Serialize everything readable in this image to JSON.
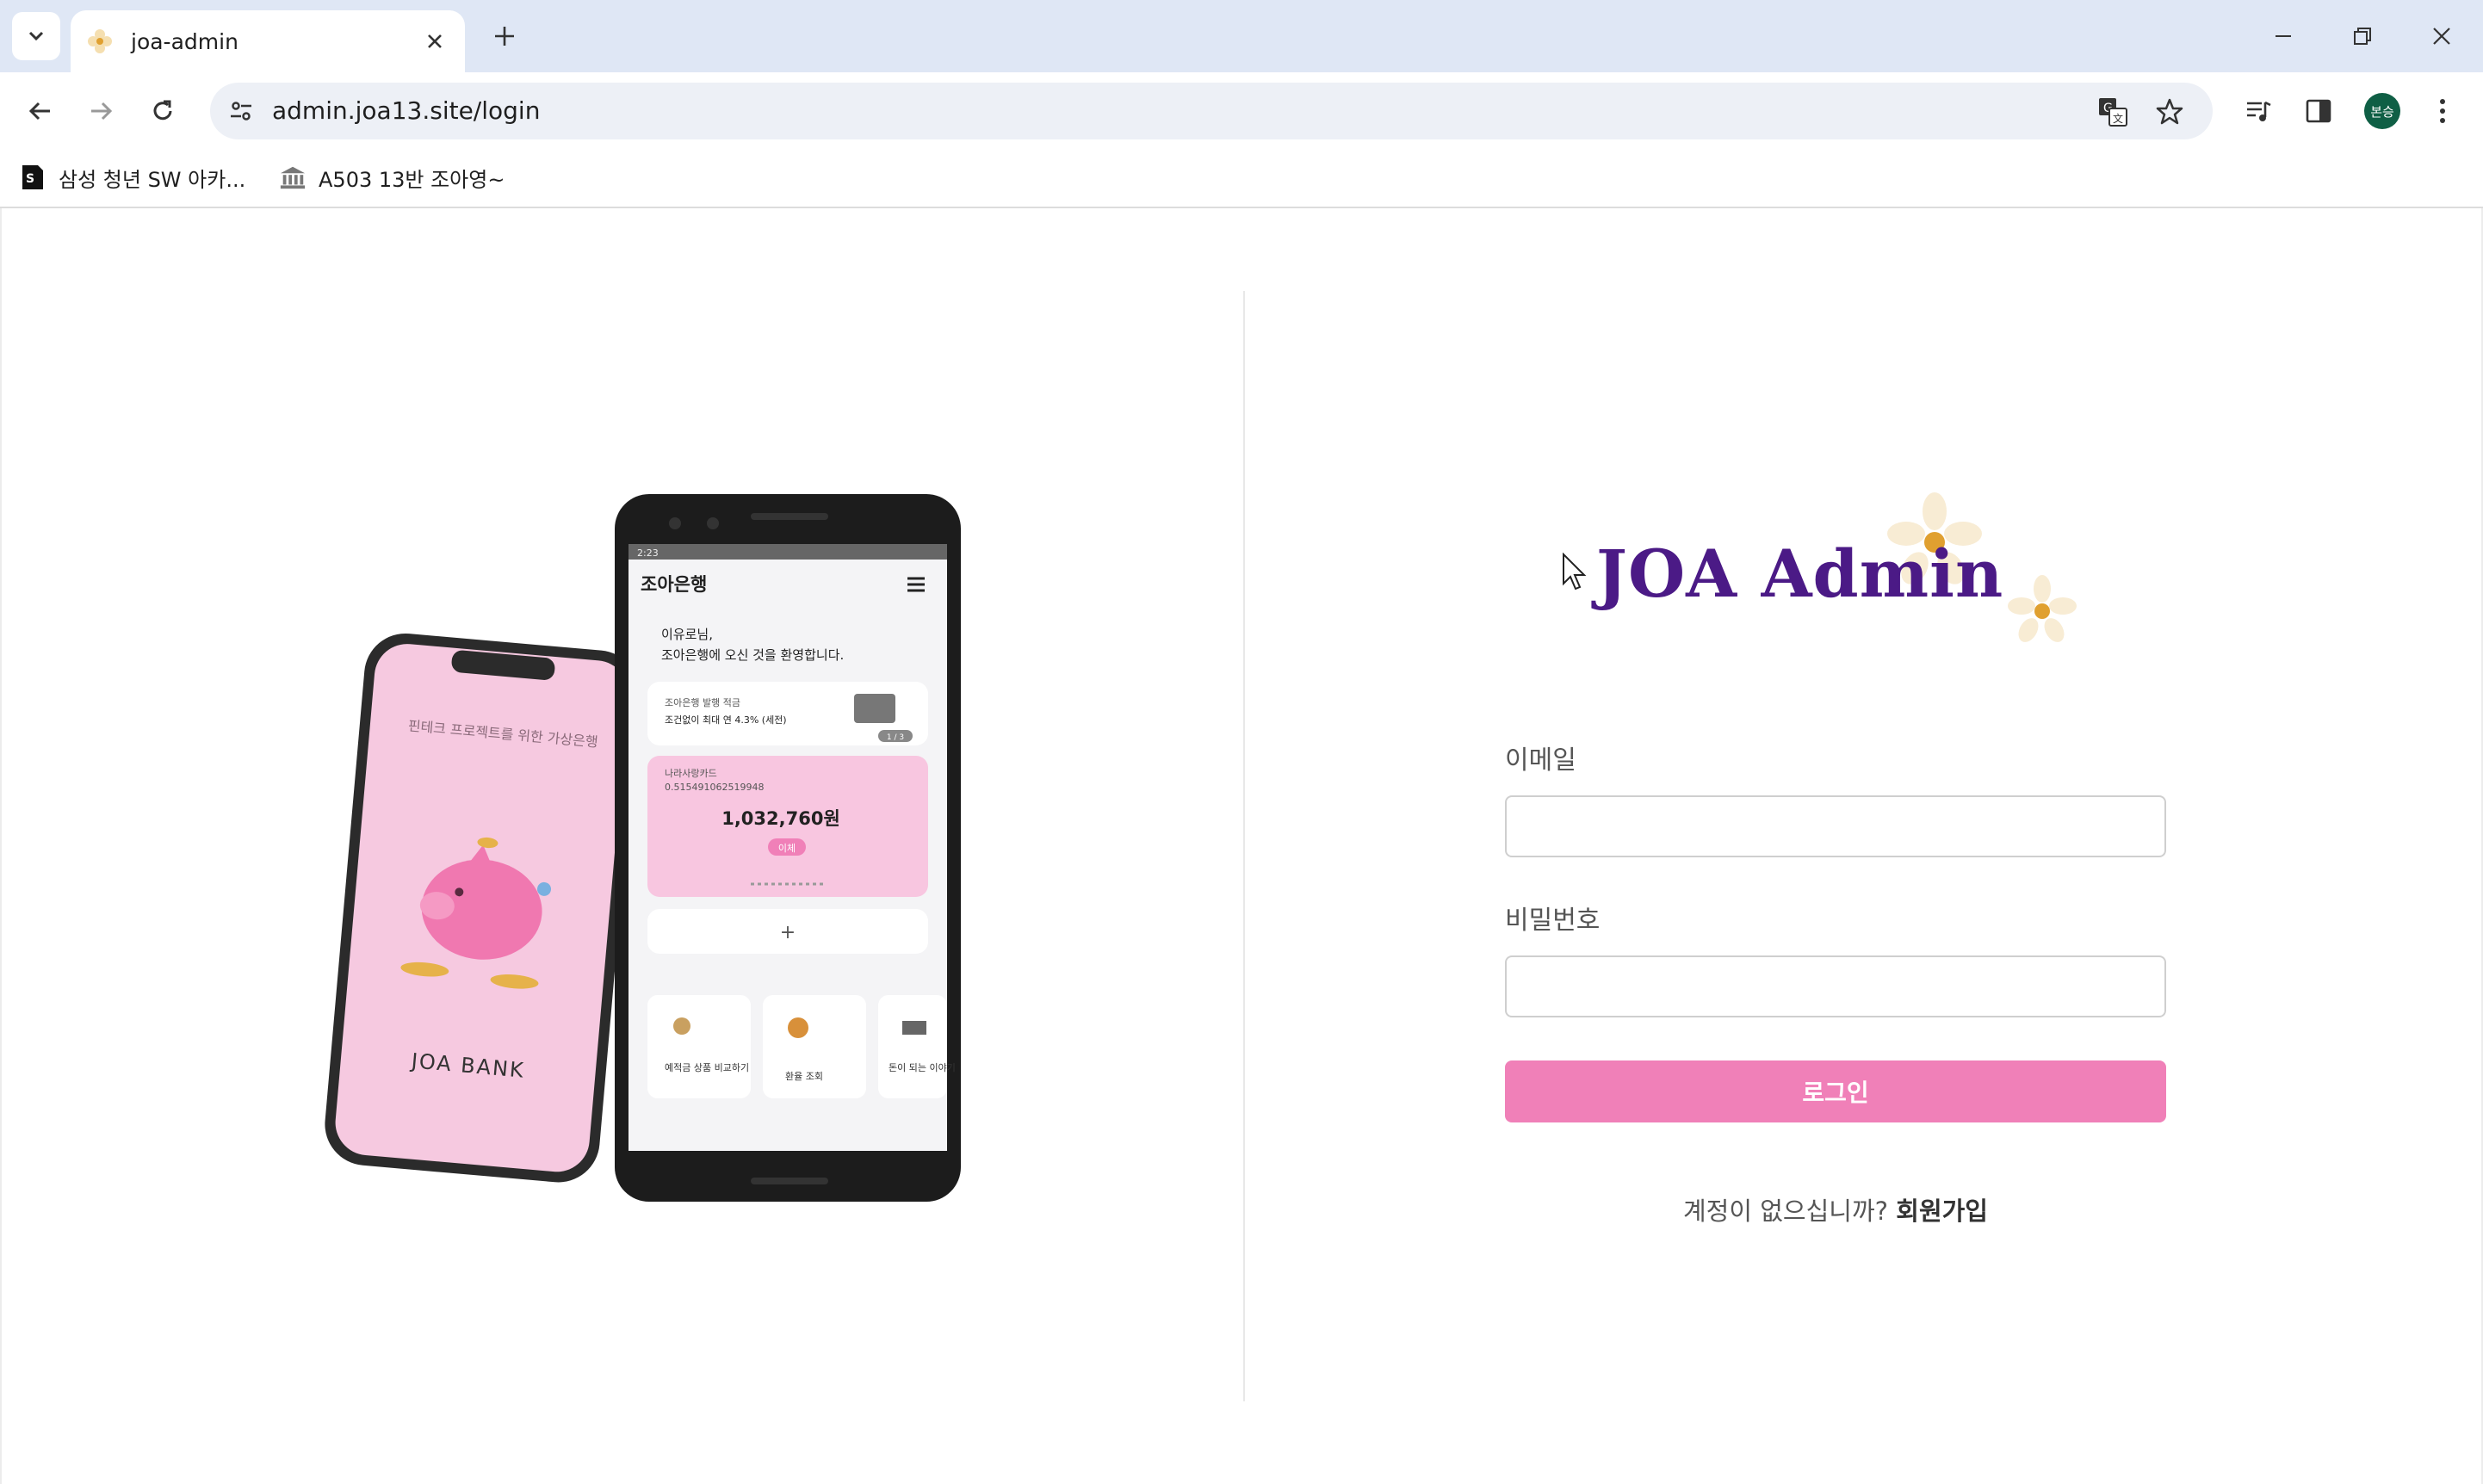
{
  "browser": {
    "tab_title": "joa-admin",
    "url": "admin.joa13.site/login",
    "profile_initials": "본승",
    "bookmarks": [
      {
        "label": "삼성 청년 SW 아카...",
        "icon": "ssafy-icon"
      },
      {
        "label": "A503 13반 조아영~",
        "icon": "bank-icon"
      }
    ]
  },
  "hero": {
    "left_phone_text": "핀테크 프로젝트를 위한 가상은행",
    "left_phone_brand": "JOA BANK",
    "right_phone": {
      "status_time": "2:23",
      "app_title": "조아은행",
      "greeting_line1": "이유로님,",
      "greeting_line2": "조아은행에 오신 것을 환영합니다.",
      "banner_line1": "조아은행 발행 적금",
      "banner_line2": "조건없이 최대 연 4.3% (세전)",
      "banner_page": "1 / 3",
      "card_name": "나라사랑카드",
      "card_number": "0.515491062519948",
      "card_balance": "1,032,760원",
      "card_action": "이체",
      "add_label": "+",
      "menu1": "예적금 상품 비교하기",
      "menu2": "환율 조회",
      "menu3": "돈이 되는 이야기"
    }
  },
  "logo": {
    "text": "JOA Admin"
  },
  "form": {
    "email_label": "이메일",
    "email_value": "",
    "password_label": "비밀번호",
    "password_value": "",
    "login_button": "로그인",
    "signup_prompt": "계정이 없으십니까?",
    "signup_link": "회원가입"
  },
  "colors": {
    "accent": "#f080b8",
    "logo": "#4b1a86",
    "chrome": "#dfe7f5"
  }
}
